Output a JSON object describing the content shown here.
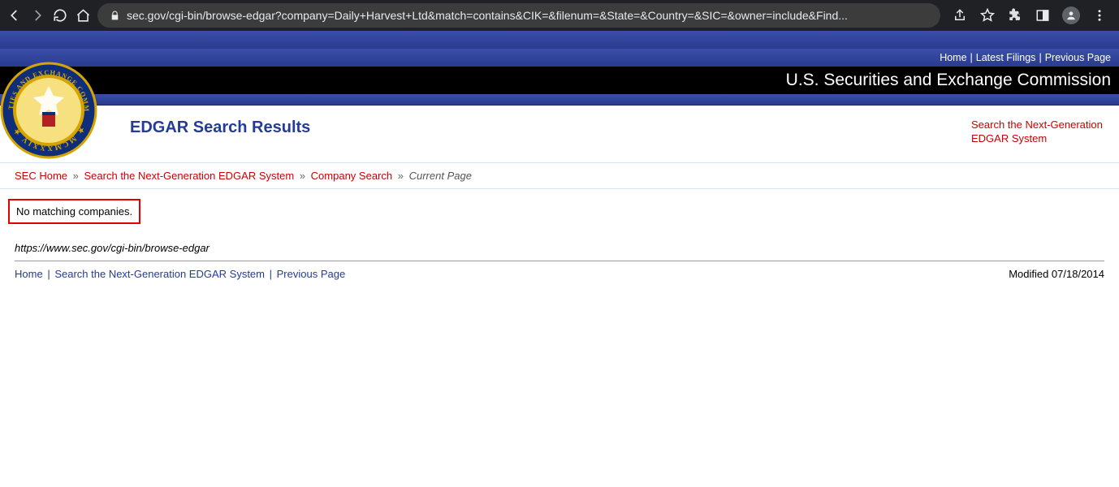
{
  "browser": {
    "url_display": "sec.gov/cgi-bin/browse-edgar?company=Daily+Harvest+Ltd&match=contains&CIK=&filenum=&State=&Country=&SIC=&owner=include&Find..."
  },
  "top_nav": {
    "home": "Home",
    "latest": "Latest Filings",
    "previous": "Previous Page"
  },
  "header": {
    "org_title": "U.S. Securities and Exchange Commission"
  },
  "title": {
    "page_title": "EDGAR Search Results",
    "next_gen_link": "Search the Next-Generation EDGAR System"
  },
  "breadcrumb": {
    "sec_home": "SEC Home",
    "next_gen": "Search the Next-Generation EDGAR System",
    "company_search": "Company Search",
    "current": "Current Page"
  },
  "result": {
    "no_match": "No matching companies."
  },
  "url_line": "https://www.sec.gov/cgi-bin/browse-edgar",
  "footer": {
    "home": "Home",
    "next_gen": "Search the Next-Generation EDGAR System",
    "previous": "Previous Page",
    "modified": "Modified 07/18/2014"
  }
}
